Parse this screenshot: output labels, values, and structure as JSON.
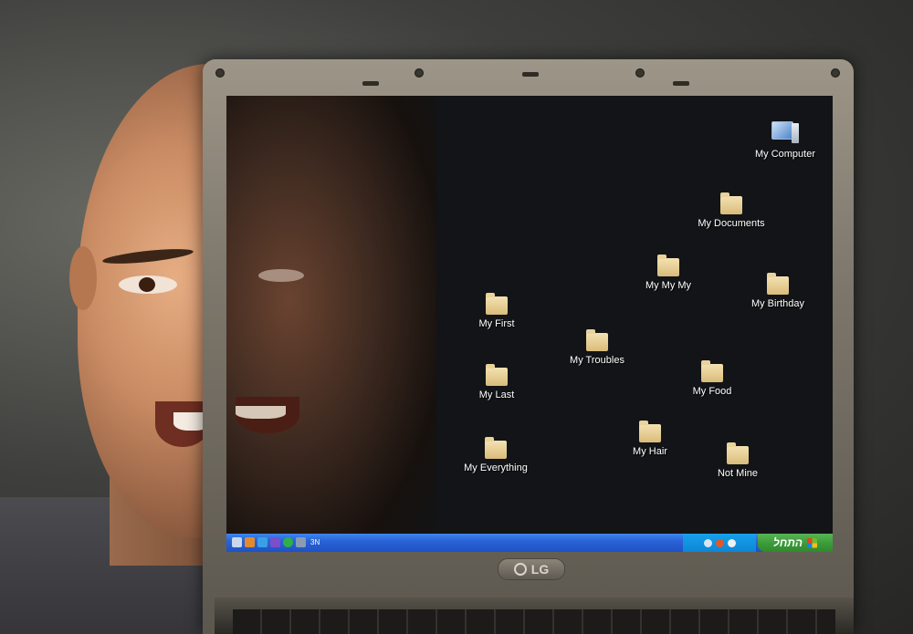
{
  "desktop": {
    "icons": [
      {
        "label": "My Computer",
        "kind": "computer"
      },
      {
        "label": "My Documents",
        "kind": "folder"
      },
      {
        "label": "My My My",
        "kind": "folder"
      },
      {
        "label": "My Birthday",
        "kind": "folder"
      },
      {
        "label": "My First",
        "kind": "folder"
      },
      {
        "label": "My Troubles",
        "kind": "folder"
      },
      {
        "label": "My Last",
        "kind": "folder"
      },
      {
        "label": "My Food",
        "kind": "folder"
      },
      {
        "label": "My Hair",
        "kind": "folder"
      },
      {
        "label": "My Everything",
        "kind": "folder"
      },
      {
        "label": "Not Mine",
        "kind": "folder"
      }
    ]
  },
  "taskbar": {
    "task_label": "3N",
    "start_label": "התחל",
    "colors": {
      "taskbar": "#2a63d6",
      "start": "#3c9a3a",
      "tray": "#0e86d6"
    }
  },
  "laptop": {
    "brand": "LG"
  }
}
